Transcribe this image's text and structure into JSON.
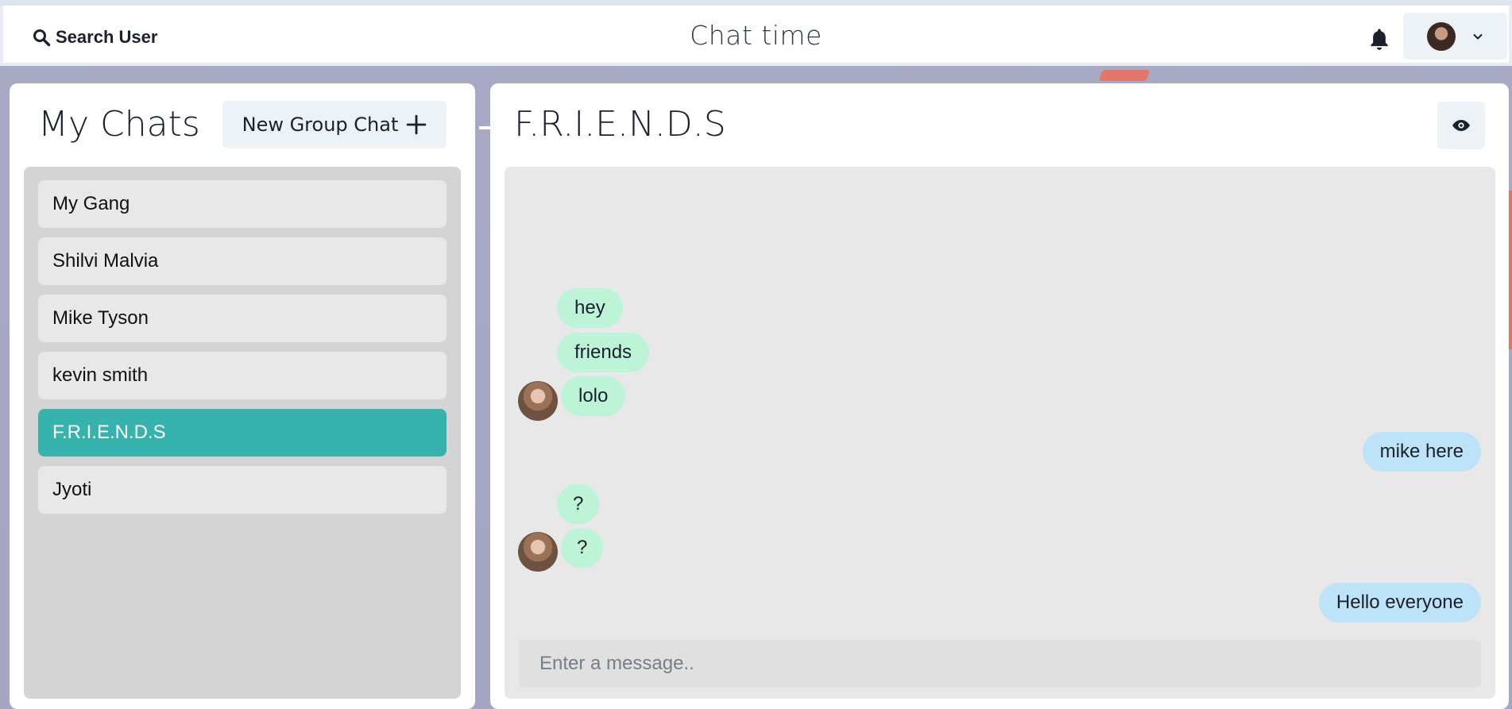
{
  "header": {
    "search_label": "Search User",
    "app_title": "Chat time"
  },
  "sidebar": {
    "title": "My Chats",
    "new_group_label": "New Group Chat",
    "chats": [
      {
        "label": "My Gang",
        "active": false
      },
      {
        "label": "Shilvi Malvia",
        "active": false
      },
      {
        "label": "Mike Tyson",
        "active": false
      },
      {
        "label": "kevin smith",
        "active": false
      },
      {
        "label": "F.R.I.E.N.D.S",
        "active": true
      },
      {
        "label": "Jyoti",
        "active": false
      }
    ]
  },
  "conversation": {
    "name": "F.R.I.E.N.D.S",
    "messages": [
      {
        "text": "hey",
        "direction": "in"
      },
      {
        "text": "friends",
        "direction": "in"
      },
      {
        "text": "lolo",
        "direction": "in"
      },
      {
        "text": "mike here",
        "direction": "out"
      },
      {
        "text": "?",
        "direction": "in"
      },
      {
        "text": "?",
        "direction": "in"
      },
      {
        "text": "Hello everyone",
        "direction": "out"
      }
    ],
    "input_placeholder": "Enter a message.."
  },
  "colors": {
    "accent": "#38b2ac",
    "incoming_bubble": "#bdf3d6",
    "outgoing_bubble": "#bee3f8"
  }
}
